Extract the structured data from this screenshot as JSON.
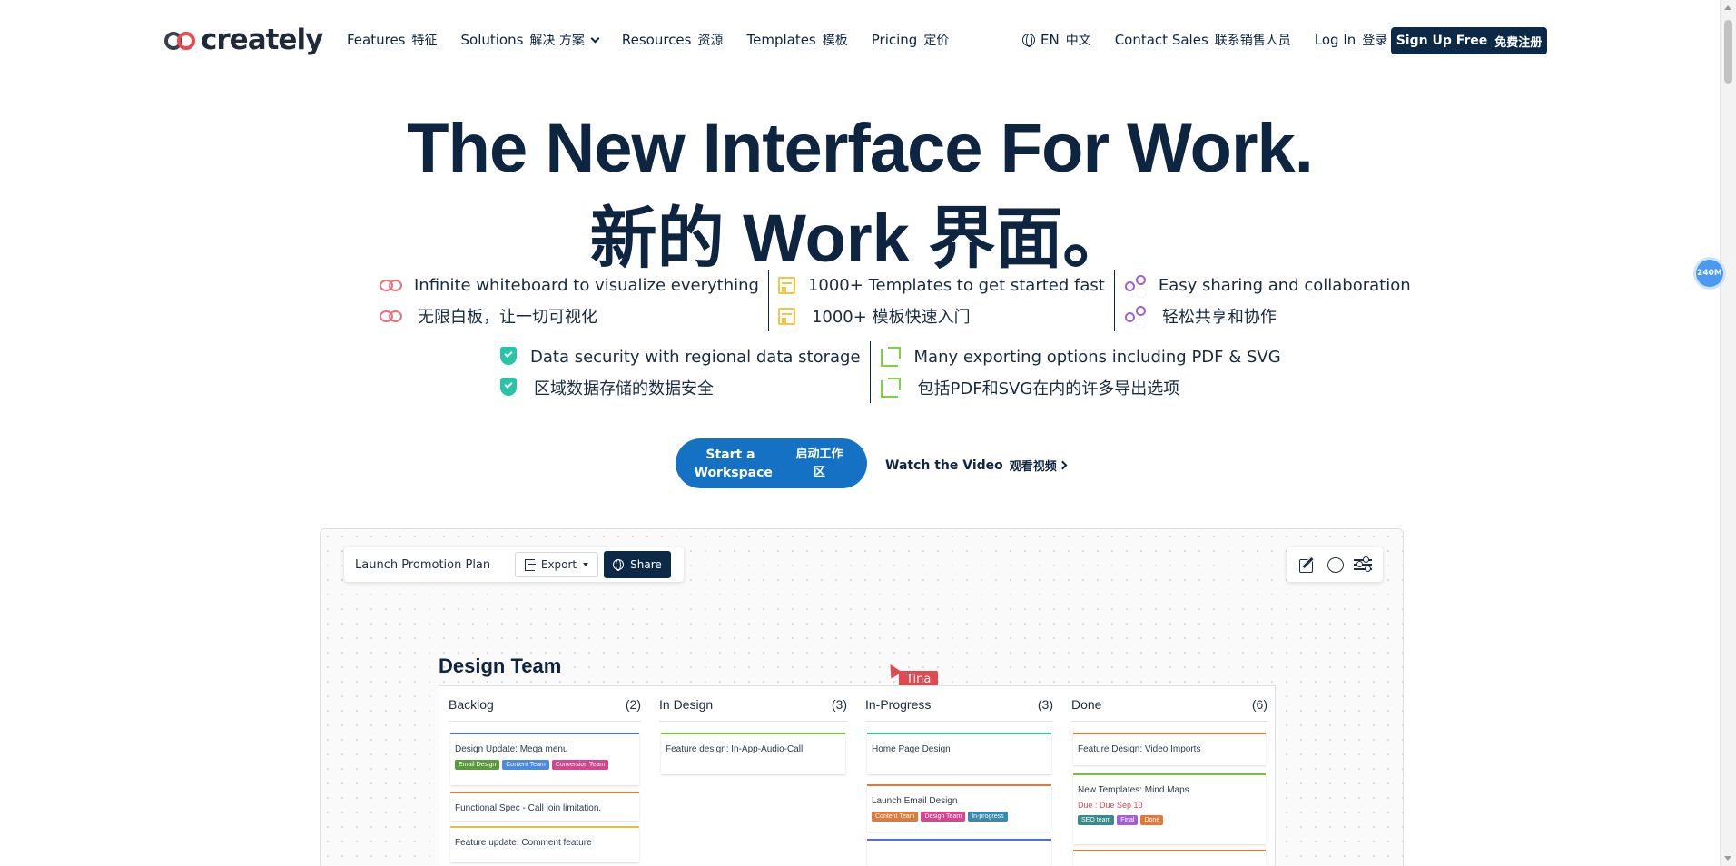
{
  "nav": {
    "logo_text": "creately",
    "links": [
      {
        "en": "Features",
        "zh": "特征"
      },
      {
        "en": "Solutions",
        "zh": "解决 方案"
      },
      {
        "en": "Resources",
        "zh": "资源"
      },
      {
        "en": "Templates",
        "zh": "模板"
      },
      {
        "en": "Pricing",
        "zh": "定价"
      }
    ],
    "lang": {
      "en": "EN",
      "zh": "中文"
    },
    "contact": {
      "en": "Contact Sales",
      "zh": "联系销售人员"
    },
    "login": {
      "en": "Log In",
      "zh": "登录"
    },
    "signup": {
      "en": "Sign Up Free",
      "zh": "免费注册"
    }
  },
  "memory_badge": "240M",
  "hero": {
    "title_en": "The New Interface For Work.",
    "title_zh": "新的 Work 界面。"
  },
  "features": [
    {
      "icon": "infinity-icon",
      "en": "Infinite whiteboard to visualize everything",
      "zh": "无限白板，让一切可视化"
    },
    {
      "icon": "template-icon",
      "en": "1000+ Templates to get started fast",
      "zh": "1000+ 模板快速入门"
    },
    {
      "icon": "share-icon",
      "en": "Easy sharing and collaboration",
      "zh": "轻松共享和协作"
    },
    {
      "icon": "shield-icon",
      "en": "Data security with regional data storage",
      "zh": "区域数据存储的数据安全"
    },
    {
      "icon": "export-icon",
      "en": "Many exporting options including PDF & SVG",
      "zh": "包括PDF和SVG在内的许多导出选项"
    }
  ],
  "cta": {
    "en": "Start a Workspace",
    "zh": "启动工作区"
  },
  "watch": {
    "en": "Watch the Video",
    "zh": "观看视频"
  },
  "preview": {
    "doc_title": "Launch Promotion Plan",
    "export_label": "Export",
    "share_label": "Share",
    "board_title": "Design Team",
    "cursor_user": "Tina",
    "columns": [
      {
        "name": "Backlog",
        "count": "(2)",
        "cards": [
          {
            "text": "Design Update: Mega menu",
            "color": "#4a6cf0",
            "tags": [
              {
                "label": "Email Design",
                "color": "#5a9a3c"
              },
              {
                "label": "Content Team",
                "color": "#4a8ae0"
              },
              {
                "label": "Conversion Team",
                "color": "#d8448e"
              }
            ]
          },
          {
            "text": "Functional Spec - Call join limitation.",
            "color": "#e07a3c",
            "tags": []
          },
          {
            "text": "Feature update: Comment feature",
            "color": "#e0c23c",
            "tags": []
          }
        ]
      },
      {
        "name": "In Design",
        "count": "(3)",
        "cards": [
          {
            "text": "Feature design: In-App-Audio-Call",
            "color": "#7ac23c",
            "tags": []
          }
        ]
      },
      {
        "name": "In-Progress",
        "count": "(3)",
        "cards": [
          {
            "text": "Home Page Design",
            "color": "#3cc28a",
            "tags": []
          },
          {
            "text": "Launch Email Design",
            "color": "#e07a3c",
            "tags": [
              {
                "label": "Content Team",
                "color": "#e07a3c"
              },
              {
                "label": "Design Team",
                "color": "#d8448e"
              },
              {
                "label": "In-progress",
                "color": "#3a8ab0"
              }
            ]
          },
          {
            "text": "",
            "color": "#4a6cf0",
            "tags": []
          }
        ]
      },
      {
        "name": "Done",
        "count": "(6)",
        "cards": [
          {
            "text": "Feature Design: Video Imports",
            "color": "#e07a3c",
            "tags": []
          },
          {
            "text": "New Templates: Mind Maps",
            "color": "#7ac23c",
            "due": "Due : Due Sep 10",
            "tags": [
              {
                "label": "SEO team",
                "color": "#3a8a8a"
              },
              {
                "label": "Final",
                "color": "#a15fd6"
              },
              {
                "label": "Done",
                "color": "#e07a3c"
              }
            ]
          },
          {
            "text": "",
            "color": "#e07a3c",
            "tags": []
          }
        ]
      }
    ]
  }
}
